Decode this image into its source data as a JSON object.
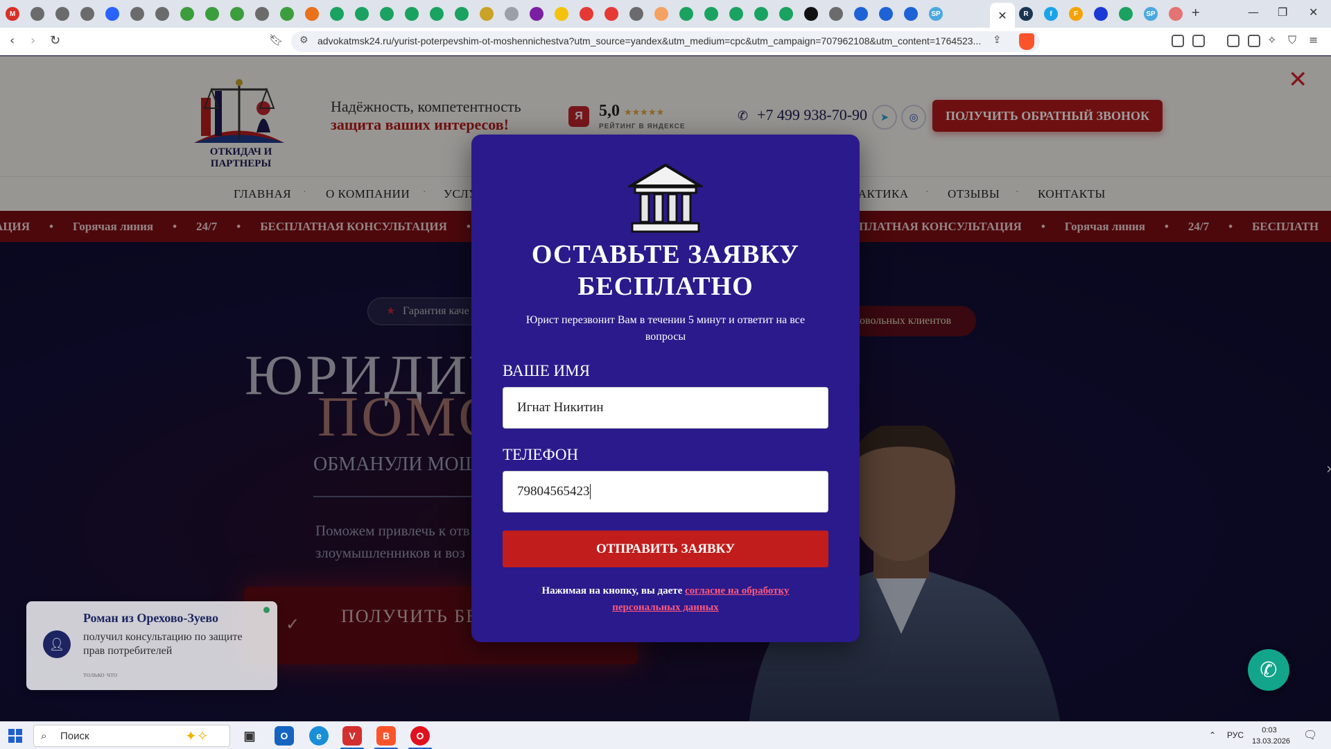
{
  "browser": {
    "active_tab_close": "✕",
    "new_tab": "+",
    "url": "advokatmsk24.ru/yurist-poterpevshim-ot-moshennichestva?utm_source=yandex&utm_medium=cpc&utm_campaign=707962108&utm_content=1764523...",
    "tab_icons": [
      {
        "label": "M",
        "color": "#d93025"
      },
      {
        "label": "",
        "color": "#6b6b6b"
      },
      {
        "label": "",
        "color": "#6b6b6b"
      },
      {
        "label": "",
        "color": "#6b6b6b"
      },
      {
        "label": "",
        "color": "#2962ff"
      },
      {
        "label": "",
        "color": "#6b6b6b"
      },
      {
        "label": "",
        "color": "#6b6b6b"
      },
      {
        "label": "",
        "color": "#3c9d3c"
      },
      {
        "label": "",
        "color": "#3c9d3c"
      },
      {
        "label": "",
        "color": "#3c9d3c"
      },
      {
        "label": "",
        "color": "#6b6b6b"
      },
      {
        "label": "",
        "color": "#3c9d3c"
      },
      {
        "label": "",
        "color": "#e8711a"
      },
      {
        "label": "",
        "color": "#1aa260"
      },
      {
        "label": "",
        "color": "#1aa260"
      },
      {
        "label": "",
        "color": "#1aa260"
      },
      {
        "label": "",
        "color": "#1aa260"
      },
      {
        "label": "",
        "color": "#1aa260"
      },
      {
        "label": "",
        "color": "#1aa260"
      },
      {
        "label": "",
        "color": "#c9a227"
      },
      {
        "label": "",
        "color": "#9aa0a6"
      },
      {
        "label": "",
        "color": "#7b1fa2"
      },
      {
        "label": "",
        "color": "#f4c20d"
      },
      {
        "label": "",
        "color": "#e53935"
      },
      {
        "label": "",
        "color": "#e53935"
      },
      {
        "label": "",
        "color": "#6b6b6b"
      },
      {
        "label": "",
        "color": "#f4a261"
      },
      {
        "label": "",
        "color": "#1aa260"
      },
      {
        "label": "",
        "color": "#1aa260"
      },
      {
        "label": "",
        "color": "#1aa260"
      },
      {
        "label": "",
        "color": "#1aa260"
      },
      {
        "label": "",
        "color": "#1aa260"
      },
      {
        "label": "",
        "color": "#111111"
      },
      {
        "label": "",
        "color": "#6b6b6b"
      },
      {
        "label": "",
        "color": "#1e63d6"
      },
      {
        "label": "",
        "color": "#1e63d6"
      },
      {
        "label": "",
        "color": "#1e63d6"
      },
      {
        "label": "SP",
        "color": "#4aa8e0"
      }
    ],
    "right_tab_icons": [
      {
        "label": "R",
        "color": "#1a3550"
      },
      {
        "label": "f",
        "color": "#1aa3e8"
      },
      {
        "label": "F",
        "color": "#f4a300"
      },
      {
        "label": "",
        "color": "#1a3ad6"
      },
      {
        "label": "",
        "color": "#1aa260"
      },
      {
        "label": "SP",
        "color": "#4aa8e0"
      },
      {
        "label": "",
        "color": "#e57373"
      }
    ]
  },
  "header": {
    "logo_text": "ОТКИДАЧ И ПАРТНЕРЫ",
    "tagline_line1": "Надёжность, компетентность",
    "tagline_line2": "защита ваших интересов!",
    "rating_badge": "Я",
    "rating_value": "5,0",
    "rating_stars": "★★★★★",
    "rating_label": "РЕЙТИНГ В ЯНДЕКСЕ",
    "phone": "+7 499 938-70-90",
    "callback_button": "ПОЛУЧИТЬ ОБРАТНЫЙ ЗВОНОК",
    "close_symbol": "✕"
  },
  "nav": {
    "home": "ГЛАВНАЯ",
    "about": "О КОМПАНИИ",
    "services": "УСЛУ",
    "practice": "РАКТИКА",
    "reviews": "ОТЗЫВЫ",
    "contacts": "КОНТАКТЫ"
  },
  "ticker": [
    "АЦИЯ",
    "•",
    "Горячая линия",
    "•",
    "24/7",
    "•",
    "БЕСПЛАТНАЯ КОНСУЛЬТАЦИЯ",
    "•",
    "Горячая лин",
    "",
    "",
    "",
    "",
    "",
    "",
    "",
    "24/7",
    "•",
    "БЕСПЛАТНАЯ КОНСУЛЬТАЦИЯ",
    "•",
    "Горячая линия",
    "•",
    "24/7",
    "•",
    "БЕСПЛАТН"
  ],
  "hero": {
    "pill_guarantee": "Гарантия каче",
    "pill_clients": "овольных клиентов",
    "title_line1": "ЮРИДИЧ",
    "title_line2": "ПОМО",
    "subtitle": "ОБМАНУЛИ МОШ",
    "text": "Поможем привлечь к отв злоумышленников и воз",
    "cta": "ПОЛУЧИТЬ БЕС КОНСУЛЬТ"
  },
  "notification": {
    "name": "Роман из Орехово-Зуево",
    "text": "получил консультацию по защите прав потребителей",
    "time": "только что"
  },
  "modal": {
    "title": "ОСТАВЬТЕ ЗАЯВКУ БЕСПЛАТНО",
    "subtitle": "Юрист перезвонит Вам в течении 5 минут и ответит на все вопросы",
    "name_label": "ВАШЕ ИМЯ",
    "name_value": "Игнат Никитин",
    "phone_label": "ТЕЛЕФОН",
    "phone_value": "79804565423",
    "submit": "ОТПРАВИТЬ ЗАЯВКУ",
    "consent_prefix": "Нажимая на кнопку, вы даете ",
    "consent_link": "согласие на обработку персональных данных"
  },
  "taskbar": {
    "search_placeholder": "Поиск",
    "lang": "РУС",
    "time": "0:03",
    "date": "13.03.2026"
  }
}
